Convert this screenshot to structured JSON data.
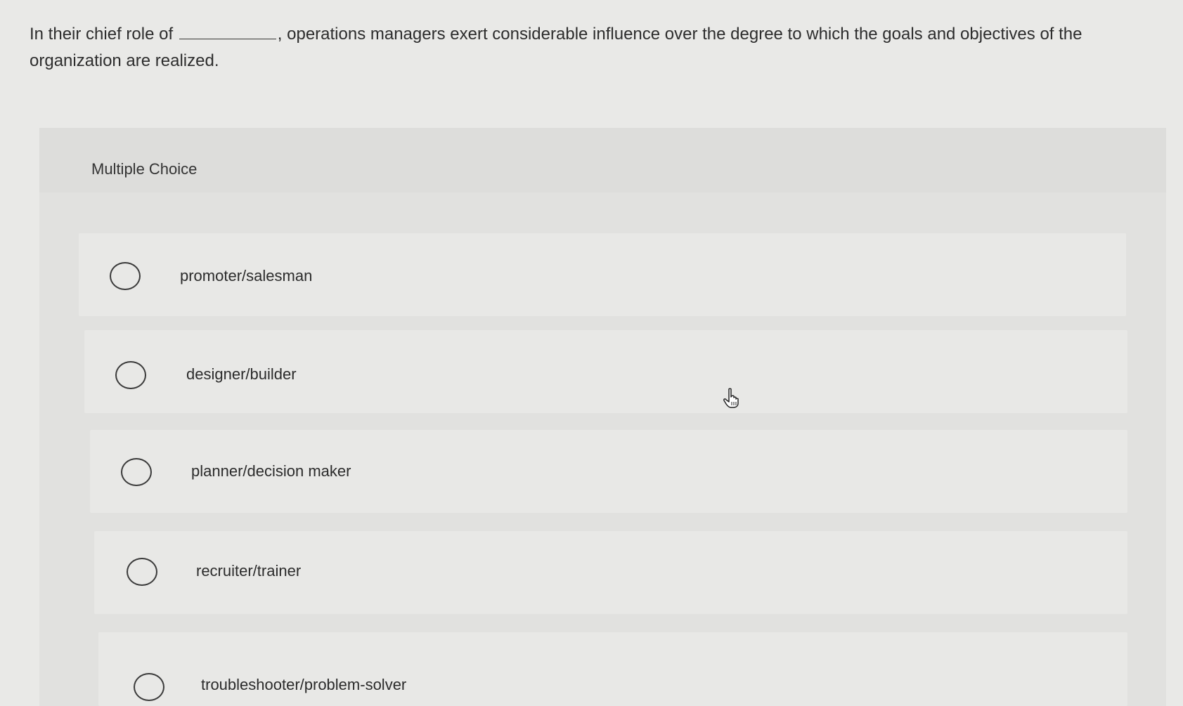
{
  "question": {
    "before_blank": "In their chief role of",
    "after_blank": ", operations managers exert considerable influence over the degree to which the goals and objectives of the organization are realized."
  },
  "multiple_choice": {
    "title": "Multiple Choice",
    "options": [
      {
        "label": "promoter/salesman",
        "selected": false
      },
      {
        "label": "designer/builder",
        "selected": false
      },
      {
        "label": "planner/decision maker",
        "selected": false
      },
      {
        "label": "recruiter/trainer",
        "selected": false
      },
      {
        "label": "troubleshooter/problem-solver",
        "selected": false
      }
    ]
  },
  "icons": {
    "cursor": "hand-pointer-icon",
    "radio": "radio-button-icon"
  }
}
